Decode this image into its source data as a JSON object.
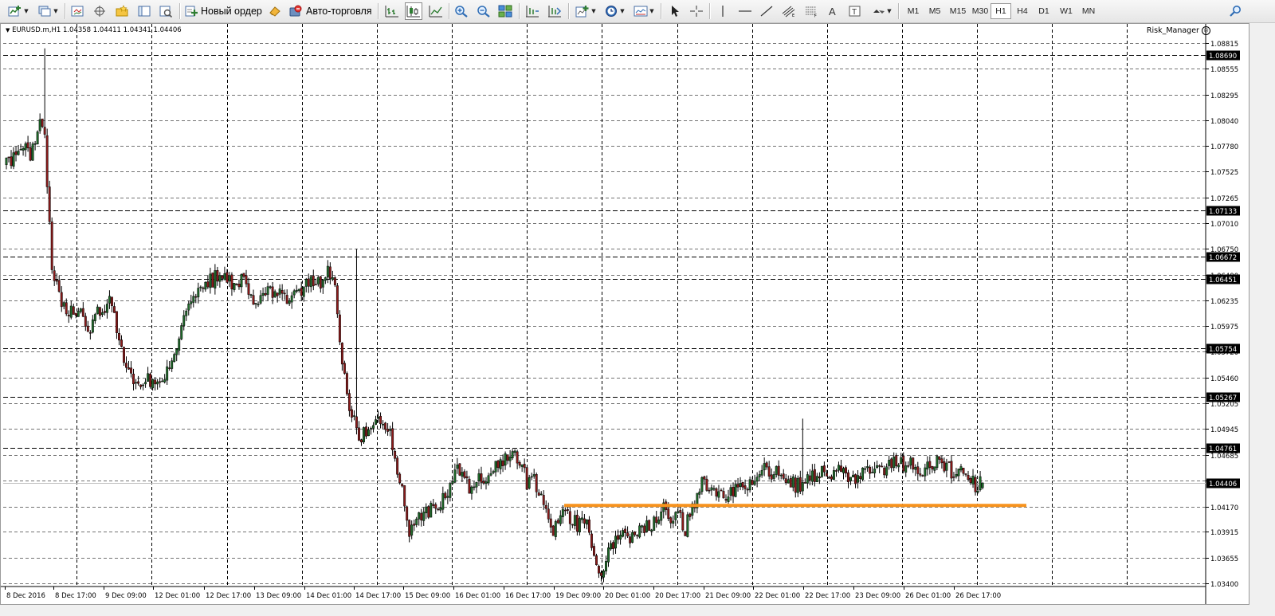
{
  "toolbar": {
    "new_order_label": "Новый ордер",
    "auto_trading_label": "Авто-торговля",
    "icons": [
      "new-chart-icon",
      "profiles-icon",
      "market-watch-icon",
      "navigator-icon",
      "favorites-icon",
      "data-window-icon",
      "strategy-tester-icon",
      "new-order-icon",
      "metaeditor-icon",
      "auto-trading-icon",
      "bar-chart-icon",
      "candlestick-icon",
      "line-chart-icon",
      "zoom-in-icon",
      "zoom-out-icon",
      "tile-windows-icon",
      "chart-shift-icon",
      "autoscroll-icon",
      "indicators-icon",
      "periods-icon",
      "templates-icon",
      "cursor-icon",
      "crosshair-icon",
      "vertical-line-icon",
      "horizontal-line-icon",
      "trend-line-icon",
      "equidistant-channel-icon",
      "fibonacci-icon",
      "text-icon",
      "text-label-icon",
      "arrows-icon",
      "search-icon"
    ],
    "timeframes": [
      "M1",
      "M5",
      "M15",
      "M30",
      "H1",
      "H4",
      "D1",
      "W1",
      "MN"
    ],
    "active_timeframe": "H1"
  },
  "chart": {
    "header": "EURUSD.m,H1  1.04358 1.04411 1.04341 1.04406",
    "indicator_label": "Risk_Manager",
    "colors": {
      "bull_body": "#1f6b2a",
      "bear_body": "#8b1a1a",
      "wick": "#000000",
      "grid": "#000000",
      "hline": "#000000",
      "support_line": "#f7931e",
      "price_tag_bg": "#000000",
      "price_tag_fg": "#ffffff",
      "current_price_line": "#c0c0c0"
    }
  },
  "chart_data": {
    "type": "candlestick",
    "symbol": "EURUSD.m",
    "timeframe": "H1",
    "ohlc_last": {
      "open": 1.04358,
      "high": 1.04411,
      "low": 1.04341,
      "close": 1.04406
    },
    "ylim": [
      1.034,
      1.09
    ],
    "y_ticks": [
      "1.08815",
      "1.08555",
      "1.08295",
      "1.08040",
      "1.07780",
      "1.07525",
      "1.07265",
      "1.07010",
      "1.06750",
      "1.06490",
      "1.06235",
      "1.05975",
      "1.05720",
      "1.05460",
      "1.05205",
      "1.04945",
      "1.04685",
      "1.04430",
      "1.04170",
      "1.03915",
      "1.03655",
      "1.03400"
    ],
    "x_ticks": [
      "8 Dec 2016",
      "8 Dec 17:00",
      "9 Dec 09:00",
      "12 Dec 01:00",
      "12 Dec 17:00",
      "13 Dec 09:00",
      "14 Dec 01:00",
      "14 Dec 17:00",
      "15 Dec 09:00",
      "16 Dec 01:00",
      "16 Dec 17:00",
      "19 Dec 09:00",
      "20 Dec 01:00",
      "20 Dec 17:00",
      "21 Dec 09:00",
      "22 Dec 01:00",
      "22 Dec 17:00",
      "23 Dec 09:00",
      "26 Dec 01:00",
      "26 Dec 17:00"
    ],
    "horizontal_levels": [
      "1.08690",
      "1.07133",
      "1.06672",
      "1.06451",
      "1.05754",
      "1.05267",
      "1.04761"
    ],
    "current_price": "1.04406",
    "support_line": {
      "price": 1.0418,
      "from": "19 Dec 09:00",
      "to": "after 26 Dec 17:00"
    },
    "grid": true,
    "close_path": [
      [
        0,
        1.076
      ],
      [
        6,
        1.0778
      ],
      [
        10,
        1.0768
      ],
      [
        14,
        1.08
      ],
      [
        16,
        1.0792
      ],
      [
        19,
        1.065
      ],
      [
        24,
        1.0615
      ],
      [
        30,
        1.0612
      ],
      [
        35,
        1.0596
      ],
      [
        40,
        1.0618
      ],
      [
        44,
        1.0622
      ],
      [
        47,
        1.058
      ],
      [
        51,
        1.055
      ],
      [
        55,
        1.0535
      ],
      [
        59,
        1.0545
      ],
      [
        63,
        1.054
      ],
      [
        67,
        1.0555
      ],
      [
        71,
        1.0575
      ],
      [
        75,
        1.061
      ],
      [
        80,
        1.0635
      ],
      [
        84,
        1.064
      ],
      [
        88,
        1.0648
      ],
      [
        94,
        1.064
      ],
      [
        99,
        1.0648
      ],
      [
        104,
        1.0615
      ],
      [
        108,
        1.063
      ],
      [
        113,
        1.0632
      ],
      [
        117,
        1.0622
      ],
      [
        121,
        1.063
      ],
      [
        126,
        1.064
      ],
      [
        130,
        1.064
      ],
      [
        134,
        1.065
      ],
      [
        137,
        1.0645
      ],
      [
        140,
        1.056
      ],
      [
        143,
        1.052
      ],
      [
        147,
        1.048
      ],
      [
        151,
        1.05
      ],
      [
        155,
        1.0505
      ],
      [
        159,
        1.0495
      ],
      [
        162,
        1.047
      ],
      [
        165,
        1.043
      ],
      [
        168,
        1.0385
      ],
      [
        171,
        1.041
      ],
      [
        174,
        1.041
      ],
      [
        178,
        1.0415
      ],
      [
        182,
        1.0425
      ],
      [
        185,
        1.044
      ],
      [
        188,
        1.046
      ],
      [
        191,
        1.0445
      ],
      [
        194,
        1.043
      ],
      [
        197,
        1.045
      ],
      [
        200,
        1.0445
      ],
      [
        203,
        1.0455
      ],
      [
        206,
        1.0463
      ],
      [
        210,
        1.0473
      ],
      [
        214,
        1.0465
      ],
      [
        217,
        1.044
      ],
      [
        220,
        1.0445
      ],
      [
        222,
        1.043
      ],
      [
        225,
        1.0408
      ],
      [
        228,
        1.039
      ],
      [
        232,
        1.041
      ],
      [
        235,
        1.0405
      ],
      [
        238,
        1.0398
      ],
      [
        242,
        1.0398
      ],
      [
        245,
        1.036
      ],
      [
        248,
        1.035
      ],
      [
        252,
        1.0375
      ],
      [
        255,
        1.0388
      ],
      [
        259,
        1.039
      ],
      [
        262,
        1.0385
      ],
      [
        265,
        1.0395
      ],
      [
        268,
        1.0398
      ],
      [
        271,
        1.0405
      ],
      [
        274,
        1.0415
      ],
      [
        277,
        1.0408
      ],
      [
        280,
        1.0408
      ],
      [
        283,
        1.0395
      ],
      [
        287,
        1.042
      ],
      [
        290,
        1.0443
      ],
      [
        294,
        1.0432
      ],
      [
        297,
        1.043
      ],
      [
        300,
        1.0425
      ],
      [
        304,
        1.0438
      ],
      [
        308,
        1.044
      ],
      [
        312,
        1.0445
      ],
      [
        316,
        1.0455
      ],
      [
        319,
        1.044
      ],
      [
        321,
        1.0455
      ],
      [
        324,
        1.0445
      ],
      [
        327,
        1.044
      ],
      [
        331,
        1.0438
      ],
      [
        335,
        1.0445
      ],
      [
        339,
        1.045
      ],
      [
        343,
        1.0448
      ],
      [
        346,
        1.0455
      ],
      [
        349,
        1.045
      ],
      [
        352,
        1.044
      ],
      [
        355,
        1.0448
      ],
      [
        358,
        1.0452
      ],
      [
        362,
        1.0453
      ],
      [
        366,
        1.0455
      ],
      [
        370,
        1.046
      ],
      [
        374,
        1.046
      ],
      [
        378,
        1.0458
      ],
      [
        382,
        1.0455
      ],
      [
        386,
        1.0462
      ],
      [
        390,
        1.0458
      ],
      [
        394,
        1.0452
      ],
      [
        398,
        1.0456
      ],
      [
        401,
        1.0448
      ],
      [
        404,
        1.0437
      ],
      [
        407,
        1.044
      ]
    ]
  }
}
